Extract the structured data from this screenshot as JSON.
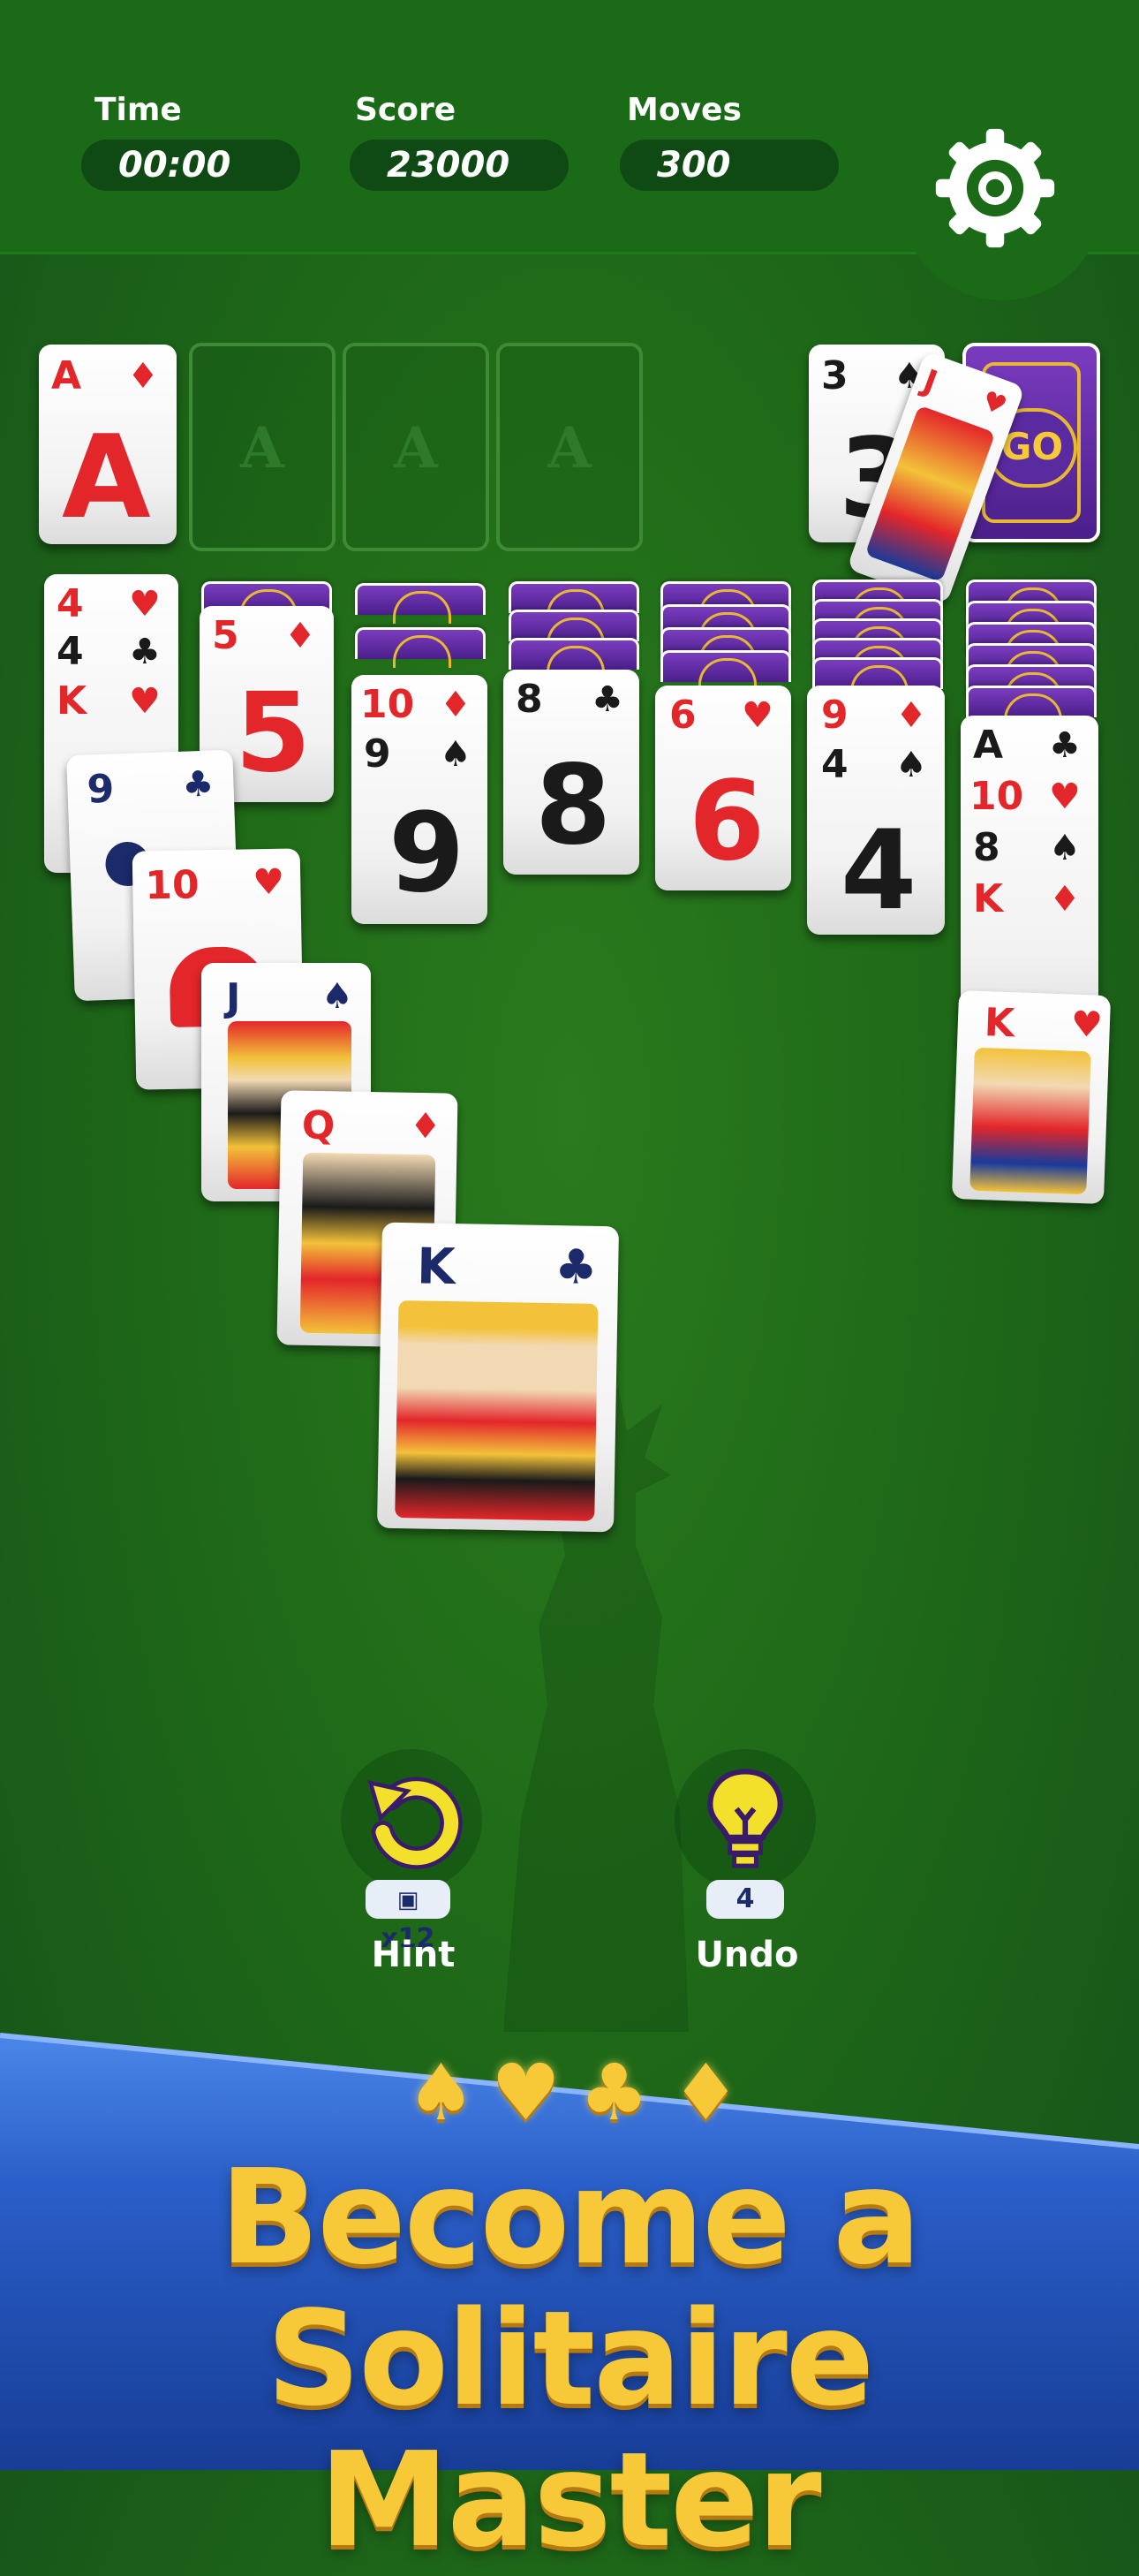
{
  "header": {
    "time_label": "Time",
    "time_value": "00:00",
    "score_label": "Score",
    "score_value": "23000",
    "moves_label": "Moves",
    "moves_value": "300",
    "settings_icon": "gear-icon"
  },
  "foundation": {
    "card1": {
      "rank": "A",
      "suit": "♦",
      "big": "A"
    },
    "empty_slot_letter": "A"
  },
  "stock": {
    "waste_top": {
      "rank": "3",
      "suit": "♠",
      "big": "3"
    },
    "flying_card": {
      "rank": "J",
      "suit": "♥"
    },
    "deck_label": "GO"
  },
  "tableau": {
    "col1": [
      {
        "rank": "4",
        "suit": "♥"
      },
      {
        "rank": "4",
        "suit": "♣"
      },
      {
        "rank": "K",
        "suit": "♥"
      }
    ],
    "col2": {
      "rank": "5",
      "suit": "♦",
      "big": "5"
    },
    "col3": [
      {
        "rank": "10",
        "suit": "♦"
      },
      {
        "rank": "9",
        "suit": "♠",
        "big": "9"
      }
    ],
    "col4": {
      "rank": "8",
      "suit": "♣",
      "big": "8"
    },
    "col5": {
      "rank": "6",
      "suit": "♥",
      "big": "6"
    },
    "col6": [
      {
        "rank": "9",
        "suit": "♦"
      },
      {
        "rank": "4",
        "suit": "♠",
        "big": "4"
      }
    ],
    "col7": [
      {
        "rank": "A",
        "suit": "♣"
      },
      {
        "rank": "10",
        "suit": "♥"
      },
      {
        "rank": "8",
        "suit": "♠"
      },
      {
        "rank": "K",
        "suit": "♦"
      }
    ],
    "col7_king": {
      "rank": "K",
      "suit": "♥"
    }
  },
  "cascade": [
    {
      "rank": "9",
      "suit": "♣"
    },
    {
      "rank": "10",
      "suit": "♥"
    },
    {
      "rank": "J",
      "suit": "♠"
    },
    {
      "rank": "Q",
      "suit": "♦"
    },
    {
      "rank": "K",
      "suit": "♣"
    }
  ],
  "controls": {
    "hint_label": "Hint",
    "hint_counter": "x12",
    "hint_icon": "undo-arrow-icon",
    "undo_label": "Undo",
    "undo_counter": "4",
    "undo_icon": "lightbulb-icon"
  },
  "banner": {
    "suits": [
      "♠",
      "♥",
      "♣",
      "♦"
    ],
    "line1": "Become a",
    "line2": "Solitaire Master"
  },
  "colors": {
    "felt": "#1f6a18",
    "card_red": "#e3262a",
    "banner_blue": "#1f4fb0",
    "gold": "#f7c938",
    "card_back": "#5a2aa0"
  }
}
